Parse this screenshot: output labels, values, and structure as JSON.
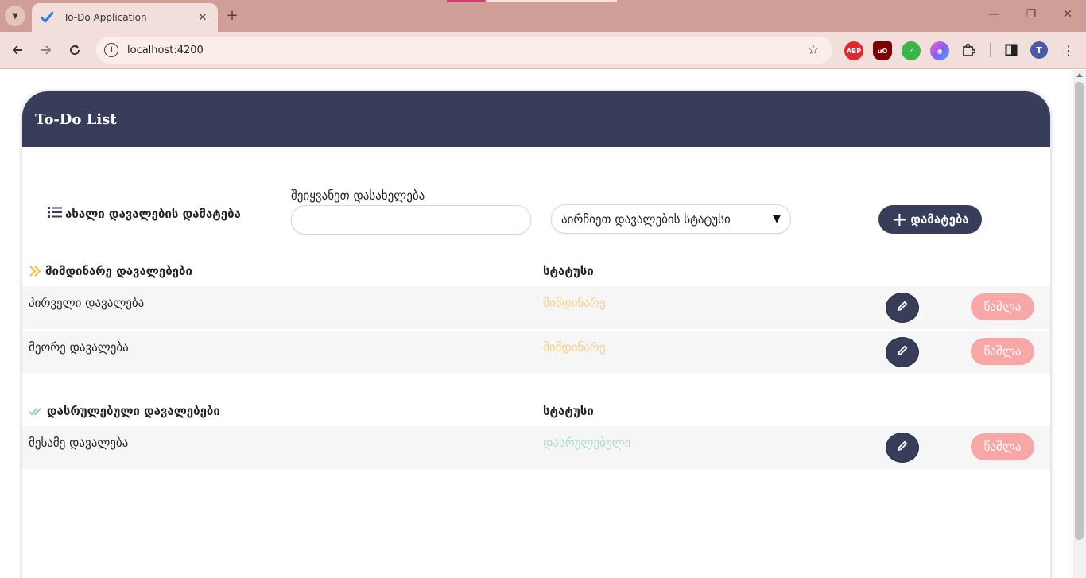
{
  "browser": {
    "tab_title": "To-Do Application",
    "url": "localhost:4200",
    "profile_initial": "T",
    "extensions": [
      "ABP",
      "uO"
    ]
  },
  "app": {
    "header_title": "To-Do List",
    "add_section_label": "ახალი დავალების დამატება",
    "name_label": "შეიყვანეთ დასახელება",
    "name_value": "",
    "status_placeholder": "აირჩიეთ დავალების სტატუსი",
    "add_button": "დამატება",
    "colors": {
      "primary": "#383d5a",
      "pending": "#f8d08a",
      "done": "#a8dfc8",
      "delete": "#f7a7a6"
    }
  },
  "current": {
    "title": "მიმდინარე დავალებები",
    "status_header": "სტატუსი",
    "tasks": [
      {
        "name": "პირველი დავალება",
        "status": "მიმდინარე",
        "delete": "წაშლა"
      },
      {
        "name": "მეორე დავალება",
        "status": "მიმდინარე",
        "delete": "წაშლა"
      }
    ]
  },
  "completed": {
    "title": "დასრულებული დავალებები",
    "status_header": "სტატუსი",
    "tasks": [
      {
        "name": "მესამე დავალება",
        "status": "დასრულებული",
        "delete": "წაშლა"
      }
    ]
  }
}
